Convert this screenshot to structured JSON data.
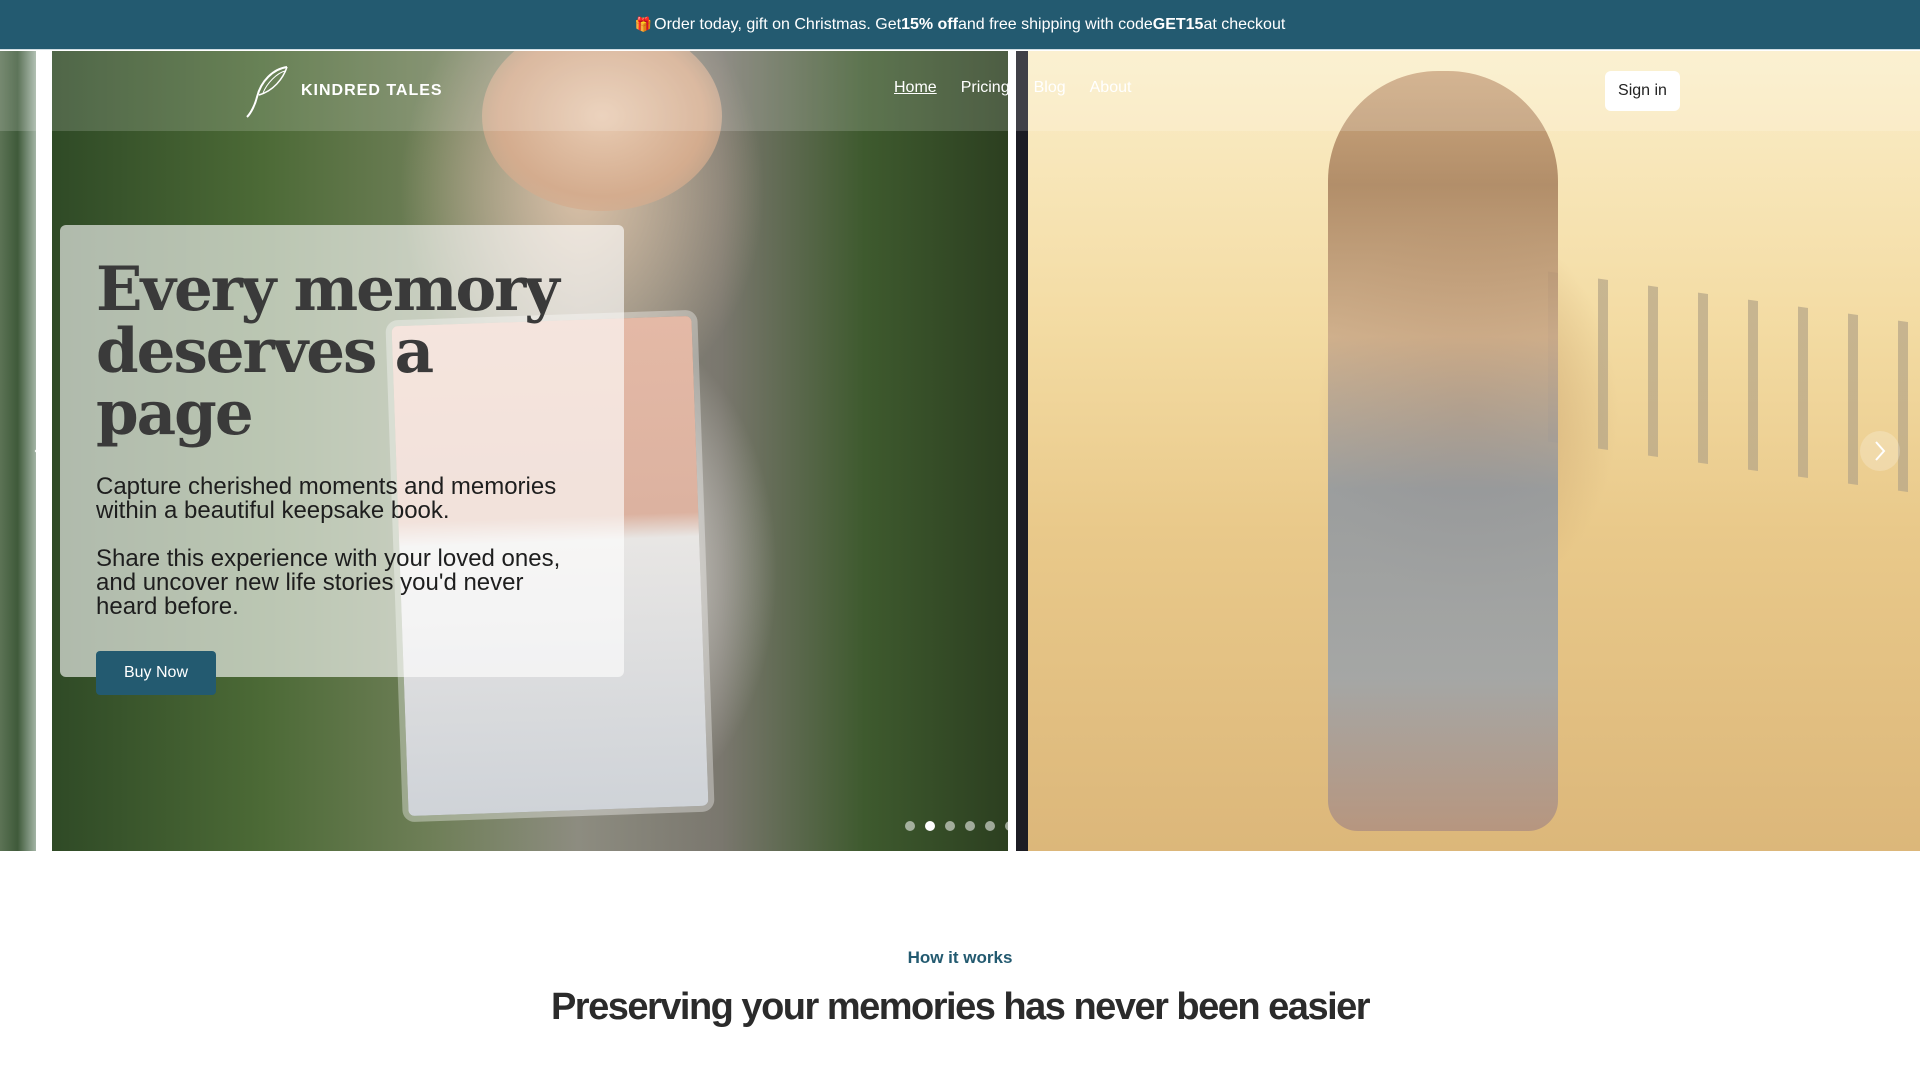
{
  "announcement": {
    "gift_icon": "🎁",
    "text_before": "Order today, gift on Christmas.  Get ",
    "discount": "15% off",
    "text_middle": " and free shipping with code ",
    "code": "GET15",
    "text_after": " at checkout"
  },
  "brand": {
    "name": "KINDRED TALES",
    "logo_icon": "quill-icon"
  },
  "nav": {
    "items": [
      {
        "label": "Home",
        "active": true
      },
      {
        "label": "Pricing",
        "active": false
      },
      {
        "label": "Blog",
        "active": false
      },
      {
        "label": "About",
        "active": false
      }
    ]
  },
  "header": {
    "signin_label": "Sign in"
  },
  "hero": {
    "title": "Every memory deserves a page",
    "paragraph1": "Capture cherished moments and memories within a beautiful keepsake book.",
    "paragraph2": "Share this experience with your loved ones, and uncover new life stories you'd never heard before.",
    "cta_label": "Buy Now",
    "prev_icon": "chevron-left-icon",
    "next_icon": "chevron-right-icon",
    "slide_count": 6,
    "active_slide_index": 1
  },
  "how_it_works": {
    "eyebrow": "How it works",
    "title": "Preserving your memories has never been easier"
  },
  "colors": {
    "primary": "#235a70",
    "white": "#ffffff"
  }
}
